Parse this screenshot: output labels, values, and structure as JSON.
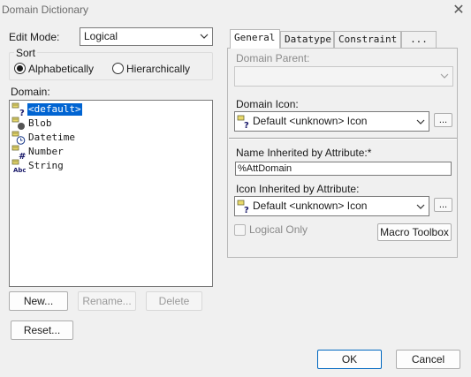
{
  "window": {
    "title": "Domain Dictionary",
    "close_glyph": "✕"
  },
  "edit_mode": {
    "label": "Edit Mode:",
    "value": "Logical"
  },
  "sort": {
    "label": "Sort",
    "options": [
      {
        "label": "Alphabetically",
        "selected": true
      },
      {
        "label": "Hierarchically",
        "selected": false
      }
    ]
  },
  "domain": {
    "label": "Domain:",
    "items": [
      {
        "label": "<default>",
        "icon": "default-domain-icon",
        "selected": true
      },
      {
        "label": "Blob",
        "icon": "blob-domain-icon",
        "selected": false
      },
      {
        "label": "Datetime",
        "icon": "datetime-domain-icon",
        "selected": false
      },
      {
        "label": "Number",
        "icon": "number-domain-icon",
        "selected": false
      },
      {
        "label": "String",
        "icon": "string-domain-icon",
        "selected": false
      }
    ]
  },
  "buttons": {
    "new": "New...",
    "rename": "Rename...",
    "delete": "Delete",
    "reset": "Reset...",
    "ok": "OK",
    "cancel": "Cancel"
  },
  "tabs": [
    {
      "label": "General",
      "active": true
    },
    {
      "label": "Datatype",
      "active": false
    },
    {
      "label": "Constraint",
      "active": false
    },
    {
      "label": "...",
      "active": false
    }
  ],
  "general": {
    "domain_parent": {
      "label": "Domain Parent:",
      "value": ""
    },
    "domain_icon": {
      "label": "Domain Icon:",
      "value": "Default <unknown> Icon",
      "browse": "..."
    },
    "name_inherited": {
      "label": "Name Inherited by Attribute:*",
      "value": "%AttDomain"
    },
    "icon_inherited": {
      "label": "Icon Inherited by Attribute:",
      "value": "Default <unknown> Icon",
      "browse": "..."
    },
    "logical_only": {
      "label": "Logical Only",
      "checked": false
    },
    "macro_toolbox": "Macro Toolbox"
  }
}
